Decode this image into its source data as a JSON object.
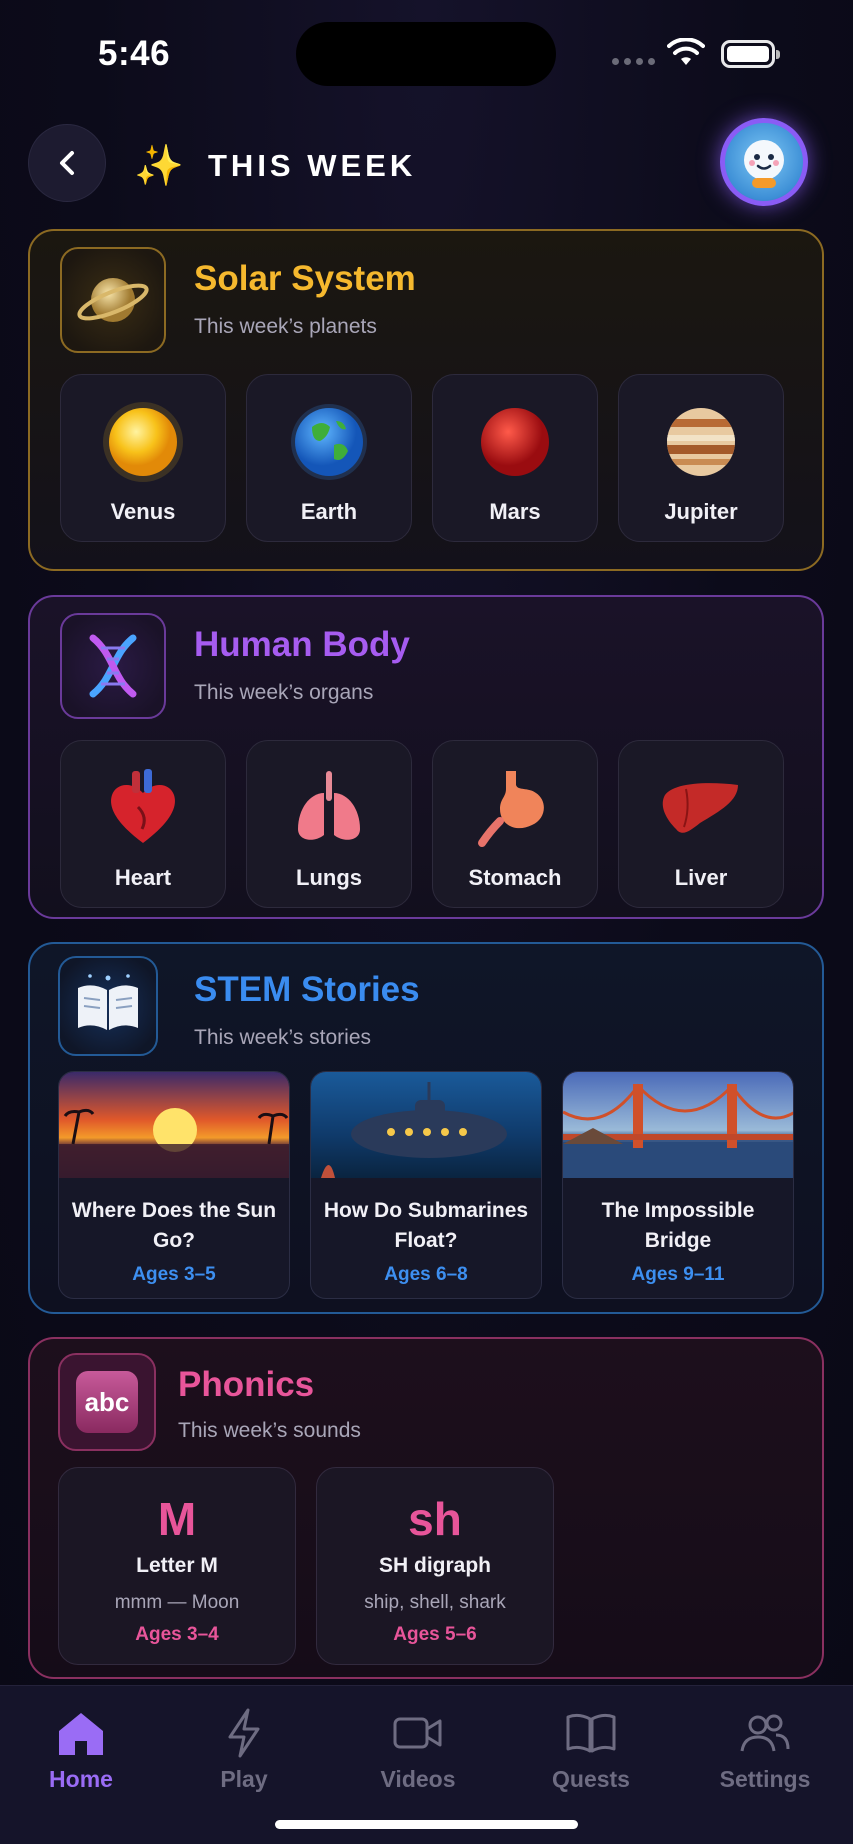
{
  "status_bar": {
    "time": "5:46"
  },
  "header": {
    "title": "THIS WEEK",
    "sparkle": "✨"
  },
  "sections": {
    "solar": {
      "title": "Solar System",
      "subtitle": "This week’s planets",
      "color": "#f5b82e",
      "items": [
        "Venus",
        "Earth",
        "Mars",
        "Jupiter"
      ]
    },
    "body": {
      "title": "Human Body",
      "subtitle": "This week’s organs",
      "color": "#a65cf0",
      "items": [
        "Heart",
        "Lungs",
        "Stomach",
        "Liver"
      ]
    },
    "stem": {
      "title": "STEM Stories",
      "subtitle": "This week’s stories",
      "color": "#3a8cf0",
      "stories": [
        {
          "title": "Where Does the Sun Go?",
          "ages": "Ages 3–5"
        },
        {
          "title": "How Do Submarines Float?",
          "ages": "Ages 6–8"
        },
        {
          "title": "The Impossible Bridge",
          "ages": "Ages 9–11"
        }
      ]
    },
    "phonics": {
      "title": "Phonics",
      "subtitle": "This week’s sounds",
      "color": "#e8559a",
      "icon_text": "abc",
      "cards": [
        {
          "glyph": "M",
          "name": "Letter M",
          "example": "mmm — Moon",
          "ages": "Ages 3–4"
        },
        {
          "glyph": "sh",
          "name": "SH digraph",
          "example": "ship, shell, shark",
          "ages": "Ages 5–6"
        }
      ]
    }
  },
  "tabbar": {
    "active": "Home",
    "accent": "#9a6cf5",
    "tabs": [
      {
        "label": "Home",
        "icon": "home-icon"
      },
      {
        "label": "Play",
        "icon": "bolt-icon"
      },
      {
        "label": "Videos",
        "icon": "video-icon"
      },
      {
        "label": "Quests",
        "icon": "book-icon"
      },
      {
        "label": "Settings",
        "icon": "people-icon"
      }
    ]
  }
}
